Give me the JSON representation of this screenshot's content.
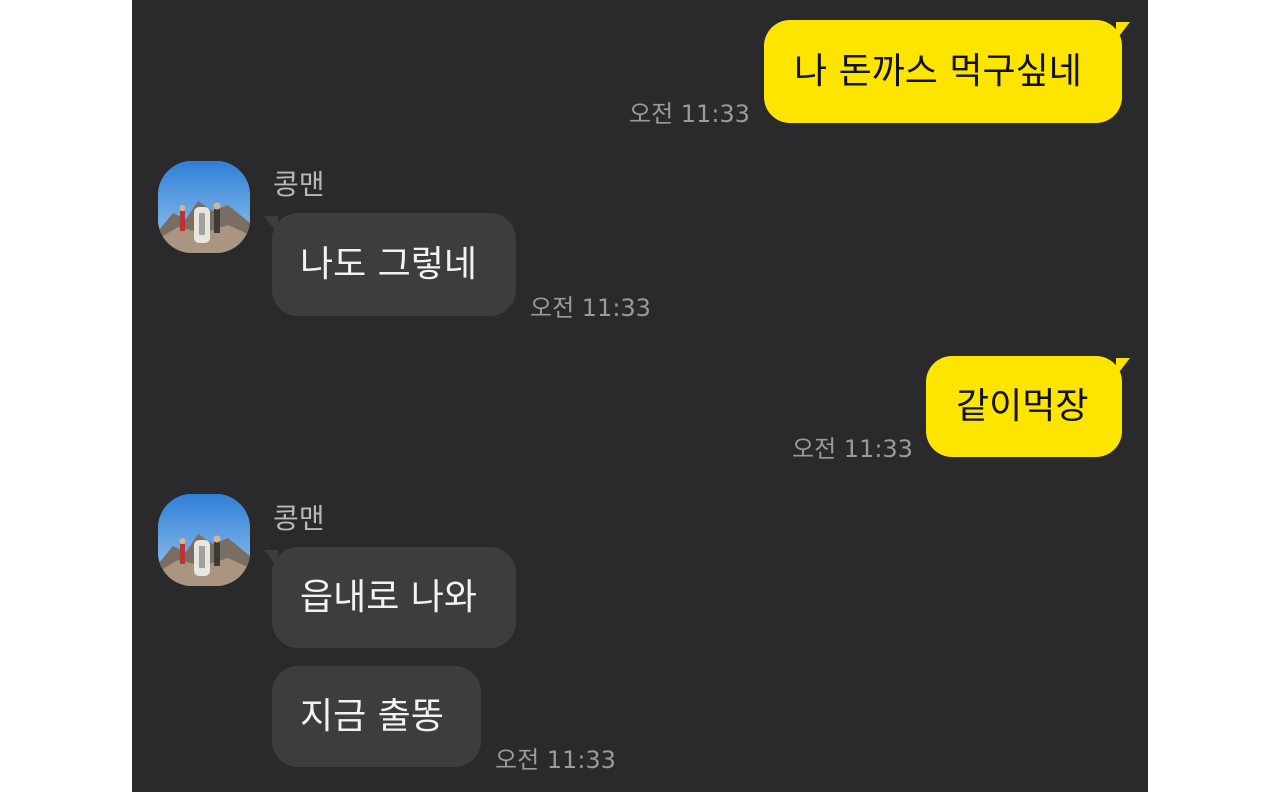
{
  "messages": {
    "m1": {
      "text": "나 돈까스 먹구싶네",
      "time": "오전 11:33"
    },
    "m2": {
      "sender": "콩맨",
      "text": "나도 그렇네",
      "time": "오전 11:33"
    },
    "m3": {
      "text": "같이먹장",
      "time": "오전 11:33"
    },
    "m4": {
      "sender": "콩맨",
      "text": "읍내로 나와"
    },
    "m5": {
      "text": "지금 출똥",
      "time": "오전 11:33"
    }
  },
  "colors": {
    "chat_background": "#2a2a2c",
    "outgoing_bubble": "#fde500",
    "incoming_bubble": "#3d3d3f",
    "timestamp": "#9a9a9c"
  },
  "icons": {
    "avatar": "profile-photo-mountain-summit"
  }
}
